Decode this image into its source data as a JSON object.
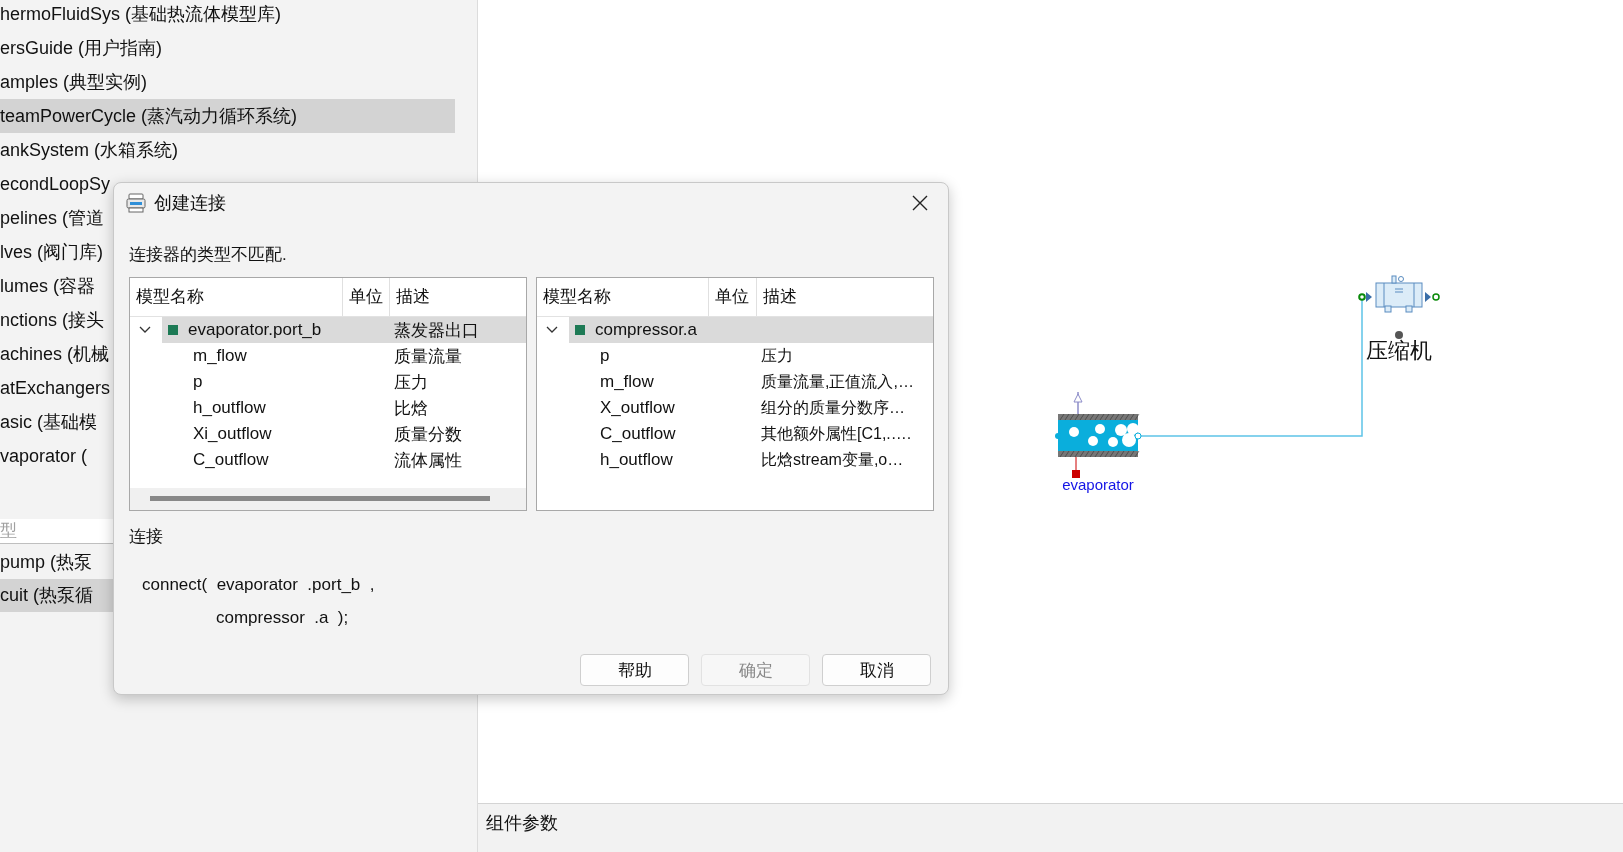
{
  "library_tree": {
    "items": [
      {
        "label": "hermoFluidSys (基础热流体模型库)",
        "selected": false
      },
      {
        "label": "ersGuide (用户指南)",
        "selected": false
      },
      {
        "label": "amples (典型实例)",
        "selected": false
      },
      {
        "label": "teamPowerCycle (蒸汽动力循环系统)",
        "selected": true
      },
      {
        "label": "ankSystem (水箱系统)",
        "selected": false
      },
      {
        "label": "econdLoopSy",
        "selected": false
      },
      {
        "label": "pelines (管道",
        "selected": false
      },
      {
        "label": "lves (阀门库)",
        "selected": false
      },
      {
        "label": "lumes (容器",
        "selected": false
      },
      {
        "label": "nctions (接头",
        "selected": false
      },
      {
        "label": "achines (机械",
        "selected": false
      },
      {
        "label": "atExchangers",
        "selected": false
      },
      {
        "label": "asic (基础模",
        "selected": false
      },
      {
        "label": "vaporator (",
        "selected": false
      }
    ]
  },
  "model_search": {
    "placeholder": "型"
  },
  "model_list": {
    "items": [
      {
        "label": "pump (热泵",
        "selected": false
      },
      {
        "label": "cuit (热泵循",
        "selected": true
      }
    ]
  },
  "canvas": {
    "components": [
      {
        "kind": "evaporator",
        "label": "evaporator"
      },
      {
        "kind": "compressor",
        "label": "压缩机"
      }
    ]
  },
  "bottom_panel": {
    "title": "组件参数"
  },
  "dialog": {
    "title": "创建连接",
    "message": "连接器的类型不匹配.",
    "tables": [
      {
        "columns": [
          "模型名称",
          "单位",
          "描述"
        ],
        "scrollable": true,
        "rows": [
          {
            "name": "evaporator.port_b",
            "description": "蒸发器出口",
            "expanded": true,
            "selected": true,
            "children": [
              {
                "name": "m_flow",
                "description": "质量流量"
              },
              {
                "name": "p",
                "description": "压力"
              },
              {
                "name": "h_outflow",
                "description": "比焓"
              },
              {
                "name": "Xi_outflow",
                "description": "质量分数"
              },
              {
                "name": "C_outflow",
                "description": "流体属性"
              }
            ]
          }
        ]
      },
      {
        "columns": [
          "模型名称",
          "单位",
          "描述"
        ],
        "scrollable": false,
        "rows": [
          {
            "name": "compressor.a",
            "expanded": true,
            "selected": true,
            "children": [
              {
                "name": "p",
                "description": "压力"
              },
              {
                "name": "m_flow",
                "description": "质量流量,正值流入,…"
              },
              {
                "name": "X_outflow",
                "description": "组分的质量分数序…"
              },
              {
                "name": "C_outflow",
                "description": "其他额外属性[C1,.…."
              },
              {
                "name": "h_outflow",
                "description": "比焓stream变量,o…"
              }
            ]
          }
        ]
      }
    ],
    "connection_label": "连接",
    "code_lines": [
      {
        "text": "connect(  evaporator  .port_b  ,",
        "indented": false
      },
      {
        "text": "compressor  .a  );",
        "indented": true
      }
    ],
    "buttons": [
      {
        "label": "帮助",
        "disabled": false
      },
      {
        "label": "确定",
        "disabled": true
      },
      {
        "label": "取消",
        "disabled": false
      }
    ]
  }
}
